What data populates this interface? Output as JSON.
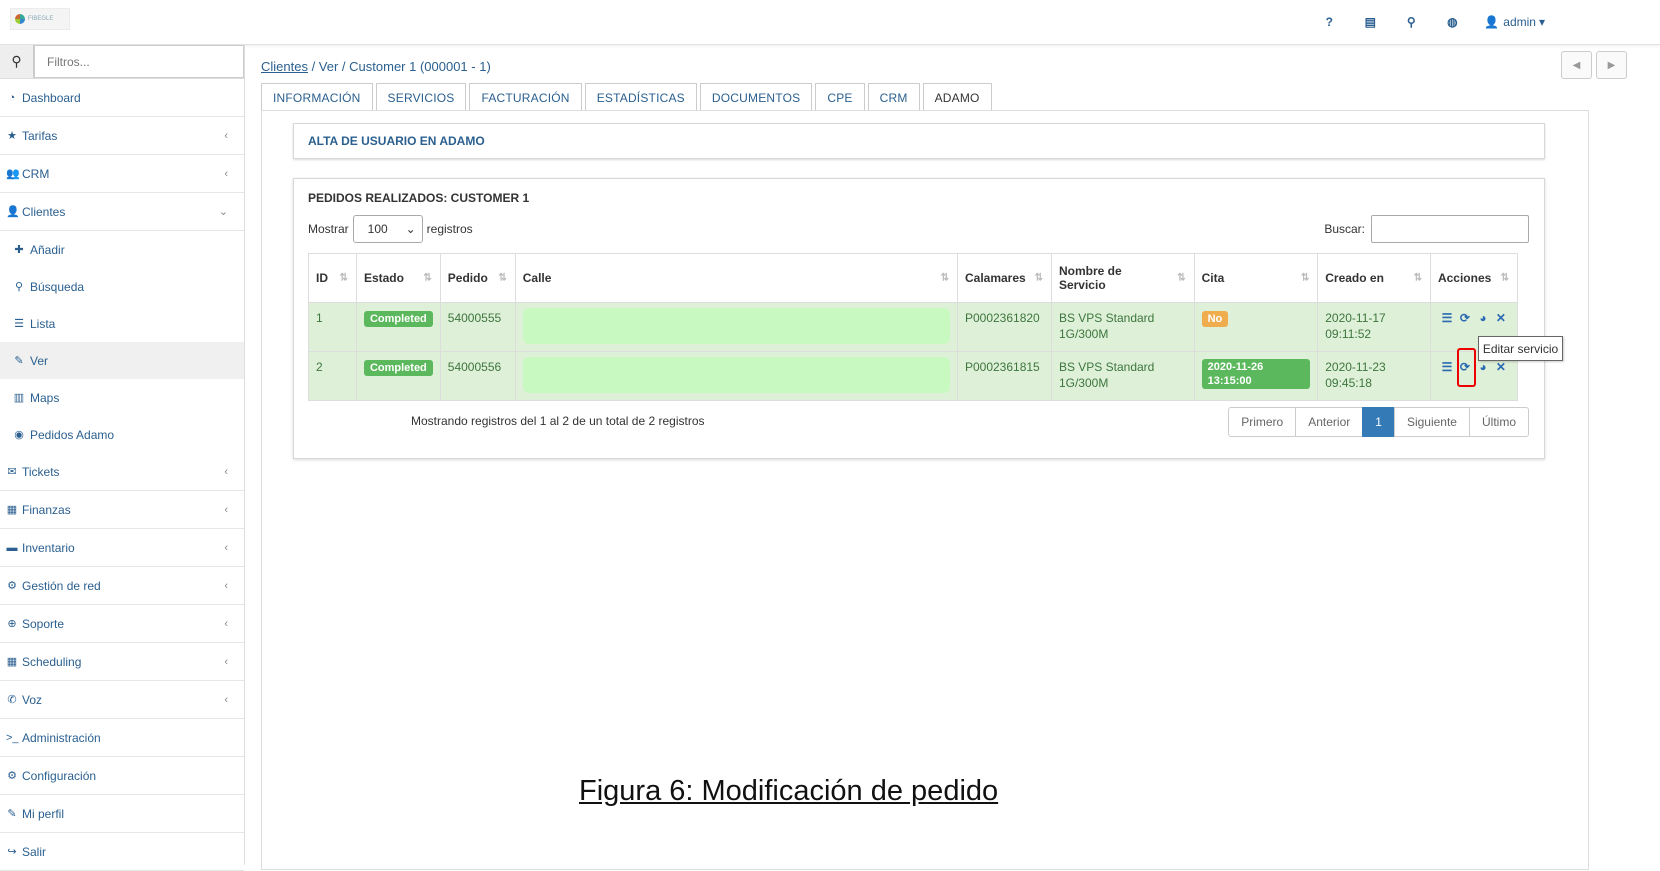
{
  "app": {
    "logo_text": "FIBEGLE"
  },
  "topbar": {
    "icons": [
      "help-icon",
      "book-icon",
      "search-icon",
      "globe-icon"
    ],
    "icon_glyphs": [
      "?",
      "▤",
      "⚲",
      "◍"
    ],
    "user": "admin",
    "user_caret": "▾"
  },
  "sidebar": {
    "filter_placeholder": "Filtros...",
    "items": [
      {
        "label": "Dashboard",
        "icon": "dashboard-icon",
        "glyph": "◔",
        "chev": ""
      },
      {
        "label": "Tarifas",
        "icon": "star-icon",
        "glyph": "★",
        "chev": "‹"
      },
      {
        "label": "CRM",
        "icon": "users-icon",
        "glyph": "👥",
        "chev": "‹"
      },
      {
        "label": "Clientes",
        "icon": "user-icon",
        "glyph": "👤",
        "chev": "⌄"
      }
    ],
    "subitems": [
      {
        "label": "Añadir",
        "icon": "plus-icon",
        "glyph": "✚"
      },
      {
        "label": "Búsqueda",
        "icon": "search-icon",
        "glyph": "⚲"
      },
      {
        "label": "Lista",
        "icon": "list-icon",
        "glyph": "☰"
      },
      {
        "label": "Ver",
        "icon": "pencil-icon",
        "glyph": "✎"
      },
      {
        "label": "Maps",
        "icon": "map-icon",
        "glyph": "▥"
      },
      {
        "label": "Pedidos Adamo",
        "icon": "adamo-icon",
        "glyph": "◉"
      }
    ],
    "items2": [
      {
        "label": "Tickets",
        "icon": "ticket-icon",
        "glyph": "✉",
        "chev": "‹"
      },
      {
        "label": "Finanzas",
        "icon": "calculator-icon",
        "glyph": "▦",
        "chev": "‹"
      },
      {
        "label": "Inventario",
        "icon": "folder-icon",
        "glyph": "▬",
        "chev": "‹"
      },
      {
        "label": "Gestión de red",
        "icon": "network-icon",
        "glyph": "⚙",
        "chev": "‹"
      },
      {
        "label": "Soporte",
        "icon": "lifebuoy-icon",
        "glyph": "⊕",
        "chev": "‹"
      },
      {
        "label": "Scheduling",
        "icon": "calendar-icon",
        "glyph": "▦",
        "chev": "‹"
      },
      {
        "label": "Voz",
        "icon": "phone-icon",
        "glyph": "✆",
        "chev": "‹"
      },
      {
        "label": "Administración",
        "icon": "terminal-icon",
        "glyph": ">_",
        "chev": ""
      },
      {
        "label": "Configuración",
        "icon": "cogs-icon",
        "glyph": "⚙",
        "chev": ""
      },
      {
        "label": "Mi perfil",
        "icon": "pencil-icon",
        "glyph": "✎",
        "chev": ""
      },
      {
        "label": "Salir",
        "icon": "logout-icon",
        "glyph": "↪",
        "chev": ""
      }
    ]
  },
  "breadcrumb": {
    "link": "Clientes",
    "rest": " / Ver / Customer 1 (000001 - 1)"
  },
  "nav": {
    "prev": "◀",
    "next": "▶"
  },
  "tabs": [
    "INFORMACIÓN",
    "SERVICIOS",
    "FACTURACIÓN",
    "ESTADÍSTICAS",
    "DOCUMENTOS",
    "CPE",
    "CRM",
    "ADAMO"
  ],
  "panel1": {
    "title": "ALTA DE USUARIO EN ADAMO"
  },
  "panel2": {
    "title": "PEDIDOS REALIZADOS: CUSTOMER 1",
    "show_label": "Mostrar",
    "show_value": "100",
    "show_suffix": "registros",
    "search_label": "Buscar:",
    "columns": [
      "ID",
      "Estado",
      "Pedido",
      "Calle",
      "Calamares",
      "Nombre de Servicio",
      "Cita",
      "Creado en",
      "Acciones"
    ],
    "rows": [
      {
        "id": "1",
        "estado": "Completed",
        "pedido": "54000555",
        "calamares": "P0002361820",
        "servicio": "BS VPS Standard 1G/300M",
        "cita": "No",
        "creado": "2020-11-17 09:11:52"
      },
      {
        "id": "2",
        "estado": "Completed",
        "pedido": "54000556",
        "calamares": "P0002361815",
        "servicio": "BS VPS Standard 1G/300M",
        "cita": "2020-11-26 13:15:00",
        "creado": "2020-11-23 09:45:18"
      }
    ],
    "info": "Mostrando registros del 1 al 2 de un total de 2 registros",
    "pager": [
      "Primero",
      "Anterior",
      "1",
      "Siguiente",
      "Último"
    ]
  },
  "tooltip": "Editar servicio",
  "caption": "Figura 6: Modificación de pedido",
  "colors": {
    "link": "#2a5f8f",
    "success": "#5cb85c",
    "warning": "#f0ad4e",
    "row_bg": "#dff0d8",
    "highlight": "#e00000"
  }
}
